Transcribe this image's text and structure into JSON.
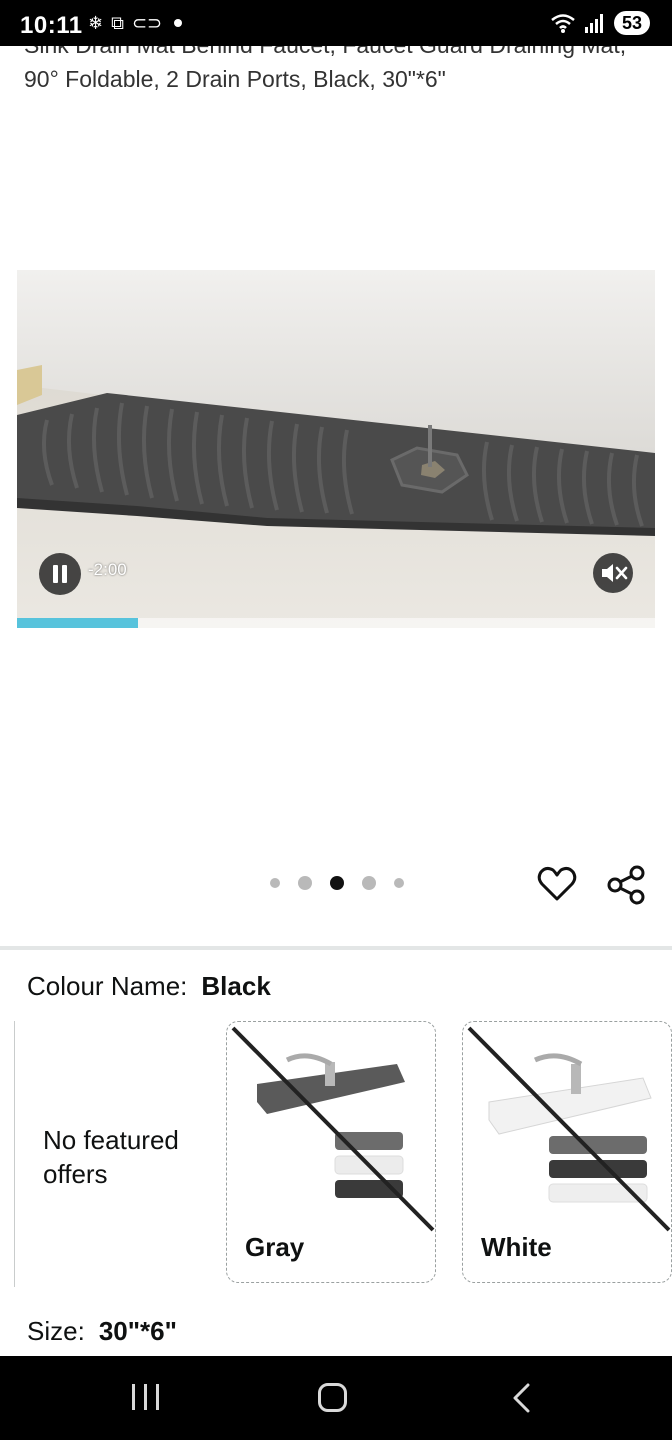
{
  "status_bar": {
    "time": "10:11",
    "battery": "53",
    "icons": [
      "snowflake-icon",
      "screenshot-icon",
      "nfc-icon",
      "dot-icon",
      "wifi-icon",
      "signal-icon",
      "battery-icon"
    ]
  },
  "product": {
    "title": "Sink Drain Mat Behind Faucet, Faucet Guard Draining Mat, 90° Foldable, 2 Drain Ports, Black, 30\"*6\""
  },
  "video": {
    "time_remaining": "-2:00",
    "progress_fraction": 0.19,
    "muted": true
  },
  "carousel": {
    "dot_count": 5,
    "active_index": 2
  },
  "colour": {
    "label": "Colour Name:",
    "selected": "Black",
    "no_offers_text": "No featured offers",
    "options": [
      {
        "name": "Gray",
        "available": false
      },
      {
        "name": "White",
        "available": false
      }
    ]
  },
  "size": {
    "label": "Size:",
    "selected": "30\"*6\""
  },
  "colors": {
    "accent_progress": "#57c3dc",
    "mat_black": "#3f3f3f"
  }
}
